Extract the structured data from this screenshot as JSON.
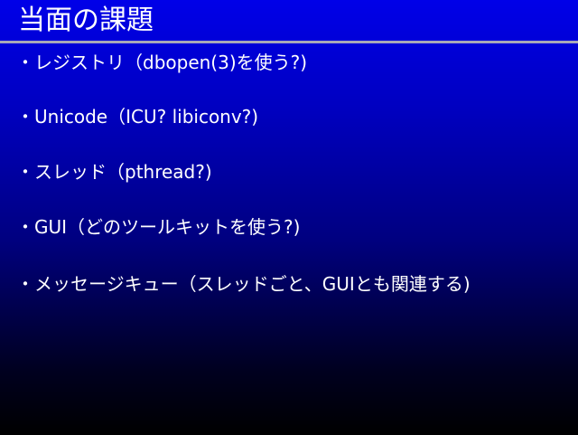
{
  "slide": {
    "title": "当面の課題",
    "bullets": [
      "・レジストリ（dbopen(3)を使う?)",
      "・Unicode（ICU? libiconv?)",
      "・スレッド（pthread?)",
      "・GUI（どのツールキットを使う?)",
      "・メッセージキュー（スレッドごと、GUIとも関連する)"
    ]
  }
}
